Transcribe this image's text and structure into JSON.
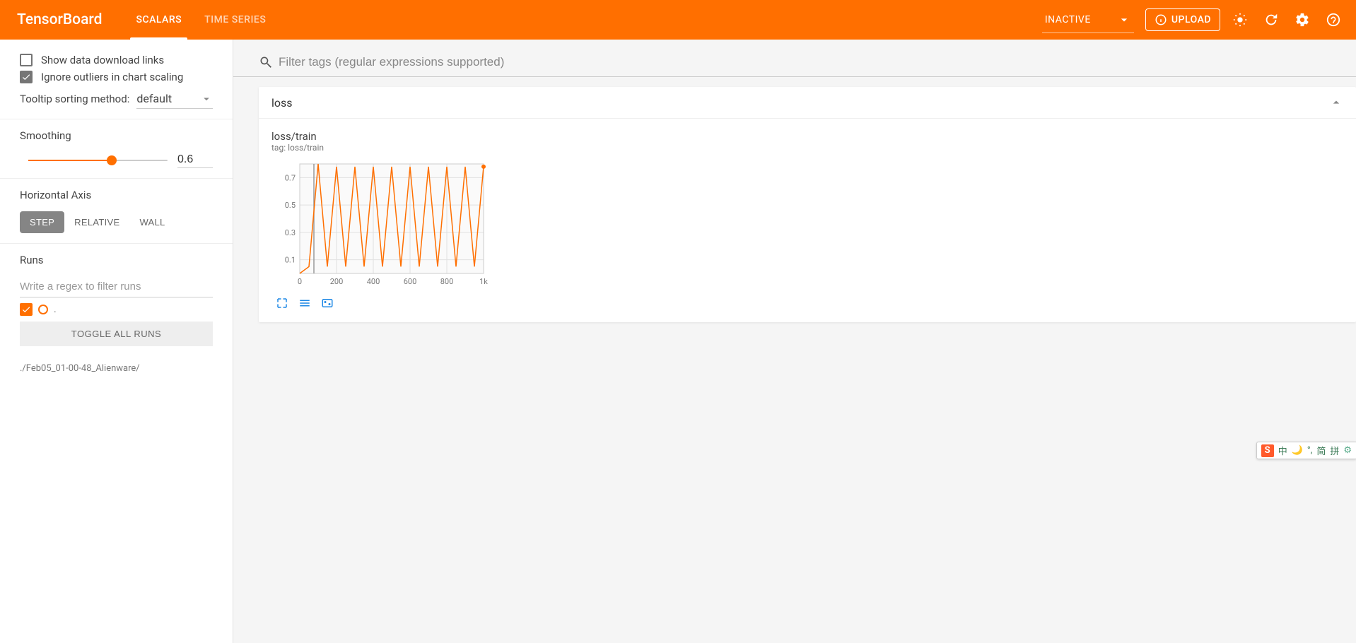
{
  "header": {
    "brand": "TensorBoard",
    "tabs": [
      {
        "label": "SCALARS",
        "active": true
      },
      {
        "label": "TIME SERIES",
        "active": false
      }
    ],
    "inactive_label": "INACTIVE",
    "upload_label": "UPLOAD"
  },
  "sidebar": {
    "show_download_label": "Show data download links",
    "show_download_checked": false,
    "ignore_outliers_label": "Ignore outliers in chart scaling",
    "ignore_outliers_checked": true,
    "tooltip_sort_label": "Tooltip sorting method:",
    "tooltip_sort_value": "default",
    "smoothing_label": "Smoothing",
    "smoothing_value": "0.6",
    "horizontal_axis_label": "Horizontal Axis",
    "axis_options": [
      {
        "label": "STEP",
        "active": true
      },
      {
        "label": "RELATIVE",
        "active": false
      },
      {
        "label": "WALL",
        "active": false
      }
    ],
    "runs_label": "Runs",
    "runs_filter_placeholder": "Write a regex to filter runs",
    "run_name": ".",
    "toggle_runs_label": "TOGGLE ALL RUNS",
    "run_path": "./Feb05_01-00-48_Alienware/"
  },
  "main": {
    "filter_placeholder": "Filter tags (regular expressions supported)",
    "categories": [
      {
        "name": "loss",
        "charts": [
          {
            "title": "loss/train",
            "subtitle": "tag: loss/train"
          }
        ]
      }
    ]
  },
  "chart_data": {
    "type": "line",
    "title": "loss/train",
    "xlabel": "",
    "ylabel": "",
    "xlim": [
      0,
      1000
    ],
    "ylim": [
      0,
      0.8
    ],
    "xticks": [
      0,
      200,
      400,
      600,
      800,
      "1k"
    ],
    "yticks": [
      0.1,
      0.3,
      0.5,
      0.7
    ],
    "series": [
      {
        "name": "loss/train",
        "color": "#ff6f00",
        "x": [
          0,
          50,
          100,
          150,
          200,
          250,
          300,
          350,
          400,
          450,
          500,
          550,
          600,
          650,
          700,
          750,
          800,
          850,
          900,
          950,
          1000
        ],
        "values": [
          0.0,
          0.05,
          0.8,
          0.05,
          0.78,
          0.05,
          0.78,
          0.05,
          0.78,
          0.05,
          0.78,
          0.05,
          0.78,
          0.05,
          0.78,
          0.05,
          0.78,
          0.05,
          0.78,
          0.05,
          0.78
        ]
      }
    ]
  },
  "ime": {
    "items": [
      "中",
      "🌙",
      "°,",
      "简",
      "拼",
      "⚙"
    ]
  }
}
